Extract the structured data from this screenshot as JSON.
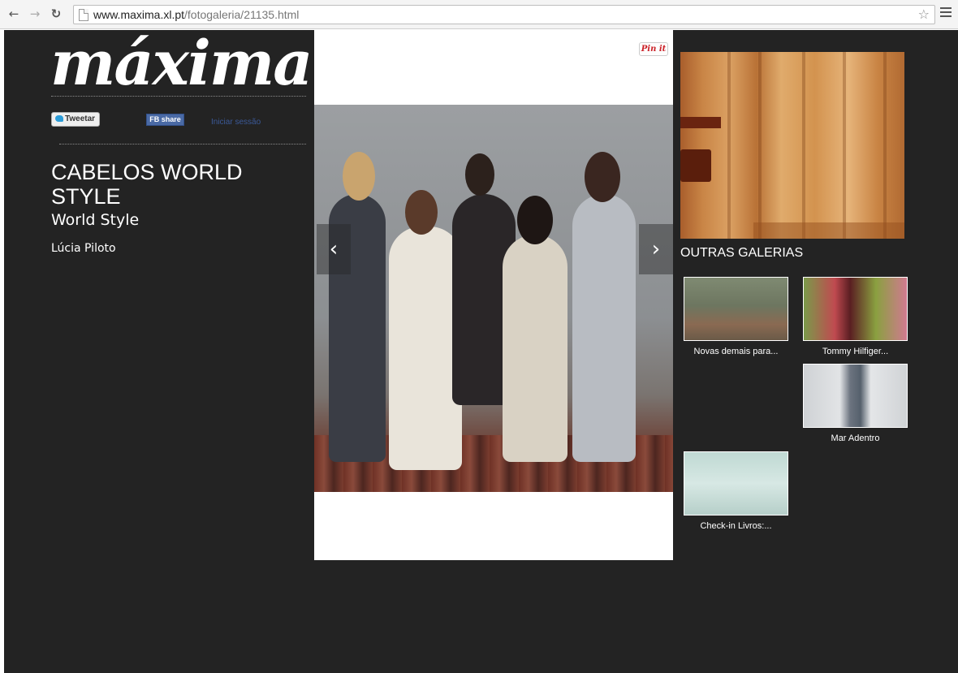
{
  "browser": {
    "url_domain": "www.maxima.xl.pt",
    "url_path": "/fotogaleria/21135.html"
  },
  "brand": {
    "logo_text": "máxima"
  },
  "social": {
    "tweet_label": "Tweetar",
    "fb_label": "FB share",
    "login_label": "Iniciar sessão",
    "pin_label": "Pin it"
  },
  "article": {
    "title": "CABELOS WORLD STYLE",
    "subtitle": "World Style",
    "author": "Lúcia Piloto"
  },
  "gallery": {
    "prev_label": "‹",
    "next_label": "›"
  },
  "sidebar": {
    "section_title": "OUTRAS GALERIAS",
    "galleries": [
      {
        "label": "Novas demais para..."
      },
      {
        "label": "Tommy Hilfiger..."
      },
      {
        "label": "Mar Adentro"
      },
      {
        "label": "Check-in Livros:..."
      }
    ]
  },
  "colors": {
    "background": "#232323",
    "accent_link": "#3b5998",
    "pinterest": "#cb2027"
  }
}
